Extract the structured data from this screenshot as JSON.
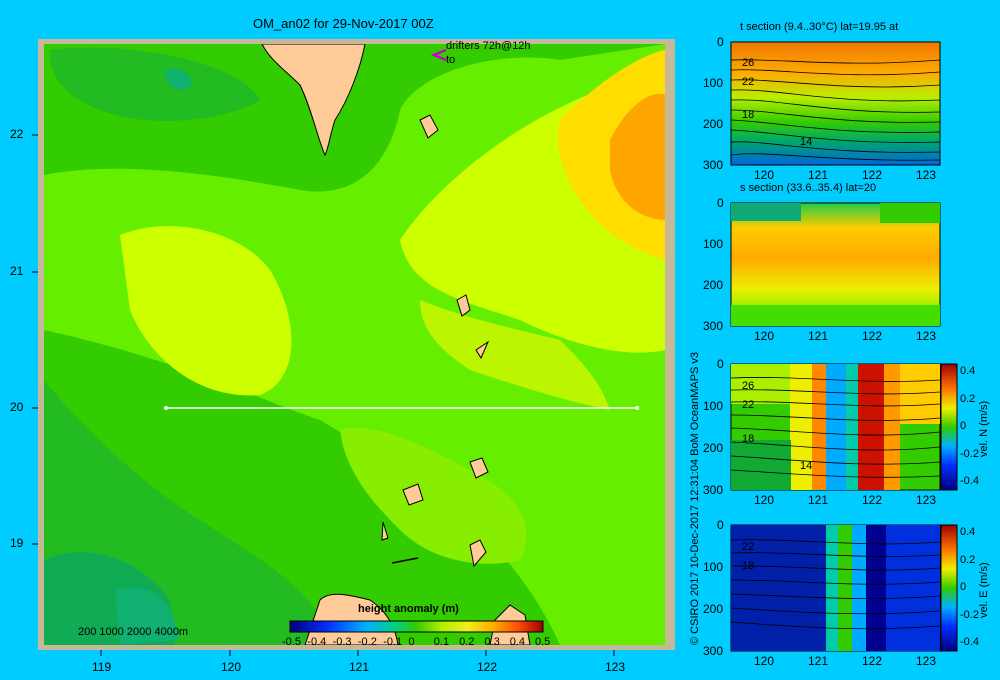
{
  "map": {
    "title": "OM_an02 for 29-Nov-2017 00Z",
    "lon_ticks": [
      "119",
      "120",
      "121",
      "122",
      "123"
    ],
    "lat_ticks": [
      "22",
      "21",
      "20",
      "19"
    ],
    "drifters_label": "drifters 72h@12h",
    "drifters_to": "to",
    "depth_legend": "200  1000  2000  4000m",
    "colorbar": {
      "title": "height anomaly (m)",
      "ticks": [
        "-0.5",
        "-0.4",
        "-0.3",
        "-0.2",
        "-0.1",
        "0",
        "0.1",
        "0.2",
        "0.3",
        "0.4",
        "0.5"
      ],
      "range": [
        -0.5,
        0.5
      ]
    },
    "section_line": {
      "lat": 20,
      "lon_start": 119.5,
      "lon_end": 123.2
    }
  },
  "credit": "© CSIRO 2017   10-Dec-2017 12:31:04 BoM OceanMAPS v3",
  "sections": [
    {
      "title": "t section (9.4..30°C) lat=19.95 at",
      "depth_ticks": [
        "0",
        "100",
        "200",
        "300"
      ],
      "lon_ticks": [
        "120",
        "121",
        "122",
        "123"
      ],
      "contour_labels": [
        "26",
        "22",
        "18",
        "14"
      ],
      "colorbar": null
    },
    {
      "title": "s section (33.6..35.4) lat=20",
      "depth_ticks": [
        "0",
        "100",
        "200",
        "300"
      ],
      "lon_ticks": [
        "120",
        "121",
        "122",
        "123"
      ],
      "contour_labels": [],
      "colorbar": null
    },
    {
      "title": "",
      "depth_ticks": [
        "0",
        "100",
        "200",
        "300"
      ],
      "lon_ticks": [
        "120",
        "121",
        "122",
        "123"
      ],
      "contour_labels": [
        "26",
        "22",
        "18",
        "14"
      ],
      "colorbar": {
        "label": "vel. N (m/s)",
        "ticks": [
          "0.4",
          "0.2",
          "0",
          "-0.2",
          "-0.4"
        ]
      }
    },
    {
      "title": "",
      "depth_ticks": [
        "0",
        "100",
        "200",
        "300"
      ],
      "lon_ticks": [
        "120",
        "121",
        "122",
        "123"
      ],
      "contour_labels": [
        "22",
        "18"
      ],
      "colorbar": {
        "label": "vel. E (m/s)",
        "ticks": [
          "0.4",
          "0.2",
          "0",
          "-0.2",
          "-0.4"
        ]
      }
    }
  ]
}
